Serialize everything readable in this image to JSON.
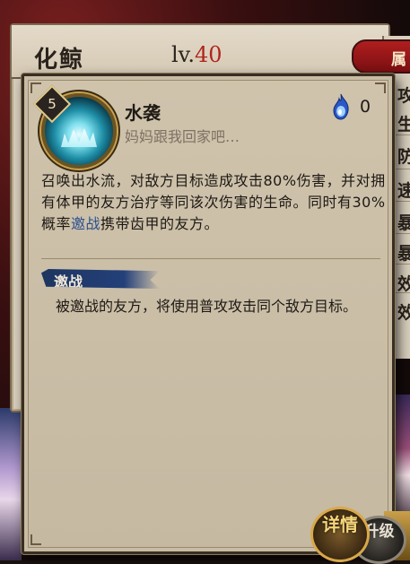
{
  "character": {
    "name": "化鲸",
    "level_prefix": "lv.",
    "level": "40"
  },
  "stats_tab": {
    "label": "属"
  },
  "stats_rows": [
    "攻",
    "生",
    "防",
    "速",
    "暴",
    "暴",
    "效",
    "效"
  ],
  "skill": {
    "level": "5",
    "name": "水袭",
    "quote": "妈妈跟我回家吧…",
    "orb_count": "0",
    "orb_icon": "blue-soul-fire-icon",
    "desc_part1": "召唤出水流，对敌方目标造成攻击80%伤害，并对拥有体甲的友方治疗等同该次伤害的生命。同时有30%概率",
    "desc_keyword": "邀战",
    "desc_part2": "携带齿甲的友方。"
  },
  "term": {
    "title": "邀战",
    "description": "被邀战的友方，将使用普攻攻击同个敌方目标。"
  },
  "buttons": {
    "detail": "详情",
    "upgrade": "升级"
  },
  "colors": {
    "keyword": "#2b4f8e",
    "level_value": "#b0241c",
    "term_banner": "#1d3560"
  }
}
